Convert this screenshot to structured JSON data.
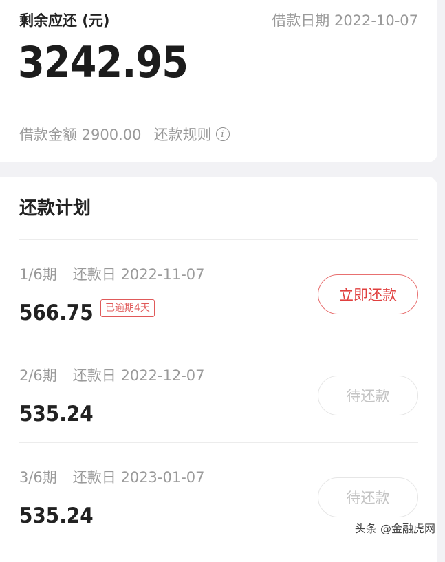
{
  "summary": {
    "remaining_label": "剩余应还 (元)",
    "loan_date": "借款日期 2022-10-07",
    "remaining_amount": "3242.95",
    "loan_amount": "借款金额 2900.00",
    "repay_rules": "还款规则",
    "info_icon": "i"
  },
  "plan": {
    "title": "还款计划",
    "items": [
      {
        "period": "1/6期",
        "due": "还款日 2022-11-07",
        "amount": "566.75",
        "badge": "已逾期4天",
        "button": "立即还款",
        "button_state": "active"
      },
      {
        "period": "2/6期",
        "due": "还款日 2022-12-07",
        "amount": "535.24",
        "button": "待还款",
        "button_state": "disabled"
      },
      {
        "period": "3/6期",
        "due": "还款日 2023-01-07",
        "amount": "535.24",
        "button": "待还款",
        "button_state": "disabled"
      }
    ]
  },
  "watermark": "头条 @金融虎网",
  "colors": {
    "accent": "#e0403f",
    "muted_text": "#9a9a9a",
    "background": "#f2f2f5"
  }
}
